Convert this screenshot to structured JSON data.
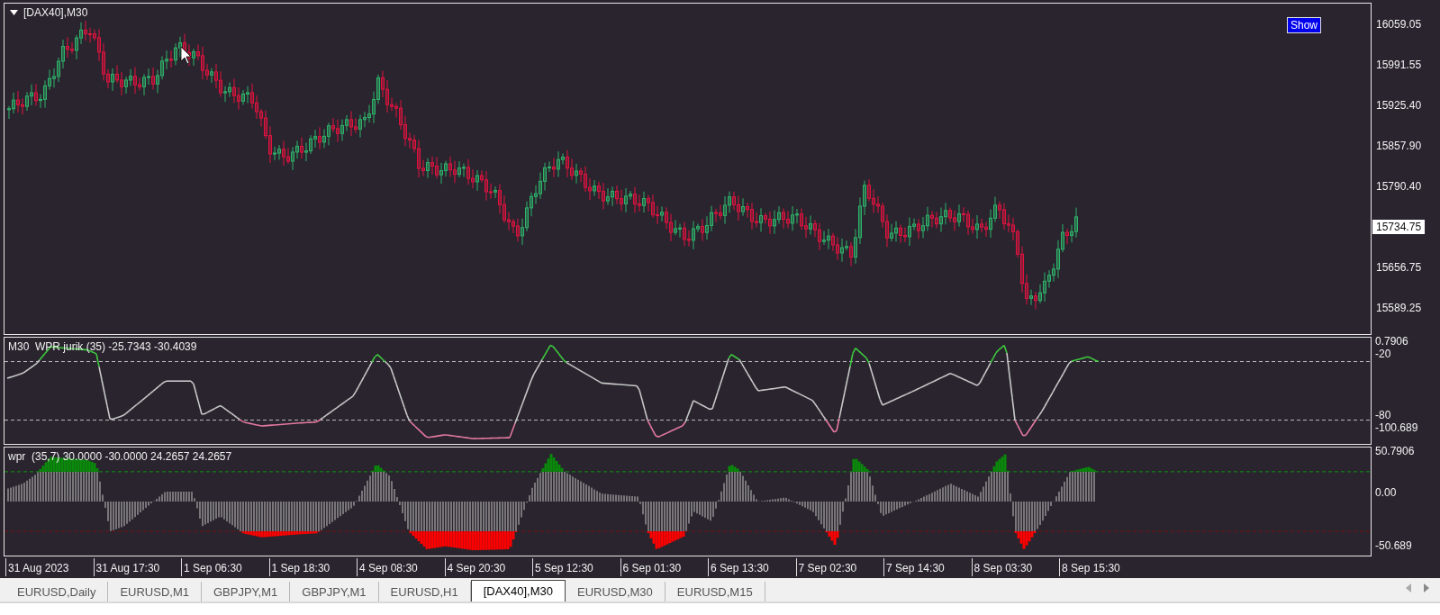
{
  "chart": {
    "title": "[DAX40],M30",
    "show_button": "Show",
    "price_axis": [
      "16059.05",
      "15991.55",
      "15925.40",
      "15857.90",
      "15790.40",
      "15656.75",
      "15589.25"
    ],
    "current_price": "15734.75"
  },
  "indicators": [
    {
      "label": "M30  WPR jurik (35) -25.7343 -30.4039",
      "axis": [
        "0.7906",
        "-20",
        "-80",
        "-100.689"
      ]
    },
    {
      "label": "wpr  (35,7) 30.0000 -30.0000 24.2657 24.2657",
      "axis": [
        "50.7906",
        "0.00",
        "-50.689"
      ]
    }
  ],
  "time_axis": [
    "31 Aug 2023",
    "31 Aug 17:30",
    "1 Sep 06:30",
    "1 Sep 18:30",
    "4 Sep 08:30",
    "4 Sep 20:30",
    "5 Sep 12:30",
    "6 Sep 01:30",
    "6 Sep 13:30",
    "7 Sep 02:30",
    "7 Sep 14:30",
    "8 Sep 03:30",
    "8 Sep 15:30"
  ],
  "tabs": [
    {
      "label": "EURUSD,Daily",
      "selected": false
    },
    {
      "label": "EURUSD,M1",
      "selected": false
    },
    {
      "label": "GBPJPY,M1",
      "selected": false
    },
    {
      "label": "GBPJPY,M1",
      "selected": false
    },
    {
      "label": "EURUSD,H1",
      "selected": false
    },
    {
      "label": "[DAX40],M30",
      "selected": true
    },
    {
      "label": "EURUSD,M30",
      "selected": false
    },
    {
      "label": "EURUSD,M15",
      "selected": false
    }
  ]
}
